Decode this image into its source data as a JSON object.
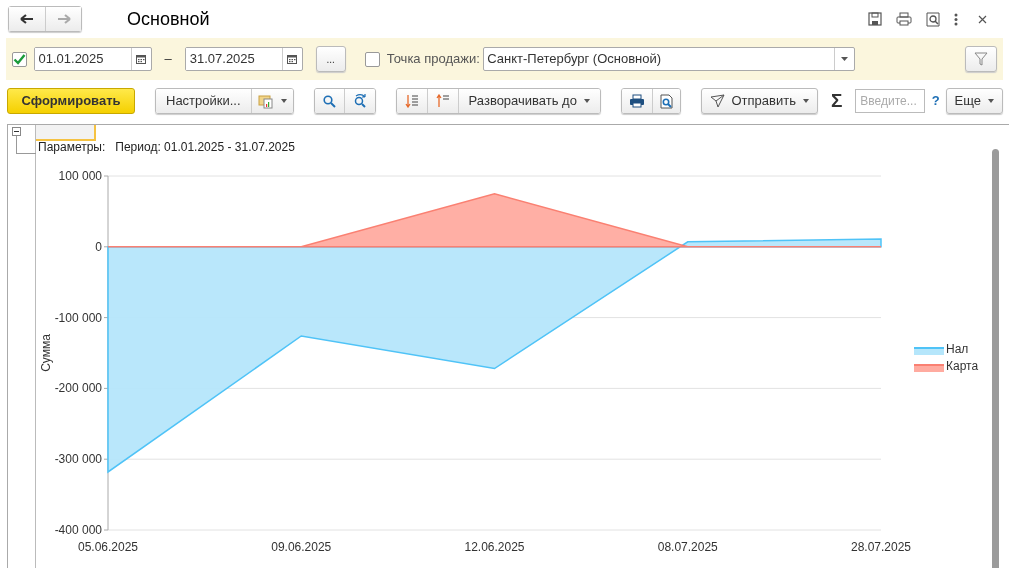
{
  "window": {
    "title": "Основной"
  },
  "filter": {
    "period_enabled": true,
    "date_from": "01.01.2025",
    "dash": "–",
    "date_to": "31.07.2025",
    "more_button": "...",
    "point_enabled": false,
    "point_label": "Точка продажи:",
    "point_value": "Санкт-Петербург (Основной)"
  },
  "toolbar": {
    "generate": "Сформировать",
    "settings": "Настройки...",
    "expand": "Разворачивать до",
    "send": "Отправить",
    "sum_symbol": "Σ",
    "search_placeholder": "Введите...",
    "help": "?",
    "more": "Еще"
  },
  "report": {
    "params_label": "Параметры:",
    "params_value": "Период: 01.01.2025 - 31.07.2025",
    "chart_data": {
      "type": "area",
      "ylabel": "Сумма",
      "categories": [
        "05.06.2025",
        "09.06.2025",
        "12.06.2025",
        "08.07.2025",
        "28.07.2025"
      ],
      "series": [
        {
          "name": "Нал",
          "color": "#4fc3f7",
          "values": [
            -318000,
            -126000,
            -172000,
            7000,
            11000
          ]
        },
        {
          "name": "Карта",
          "color": "#fa8072",
          "values": [
            0,
            0,
            75000,
            0,
            0
          ]
        }
      ],
      "ylim": [
        -400000,
        100000
      ],
      "grid": true,
      "legend": true,
      "yticks": [
        {
          "value": -400000,
          "label": "-400 000"
        },
        {
          "value": -300000,
          "label": "-300 000"
        },
        {
          "value": -200000,
          "label": "-200 000"
        },
        {
          "value": -100000,
          "label": "-100 000"
        },
        {
          "value": 0,
          "label": "0"
        },
        {
          "value": 100000,
          "label": "100 000"
        }
      ]
    }
  }
}
